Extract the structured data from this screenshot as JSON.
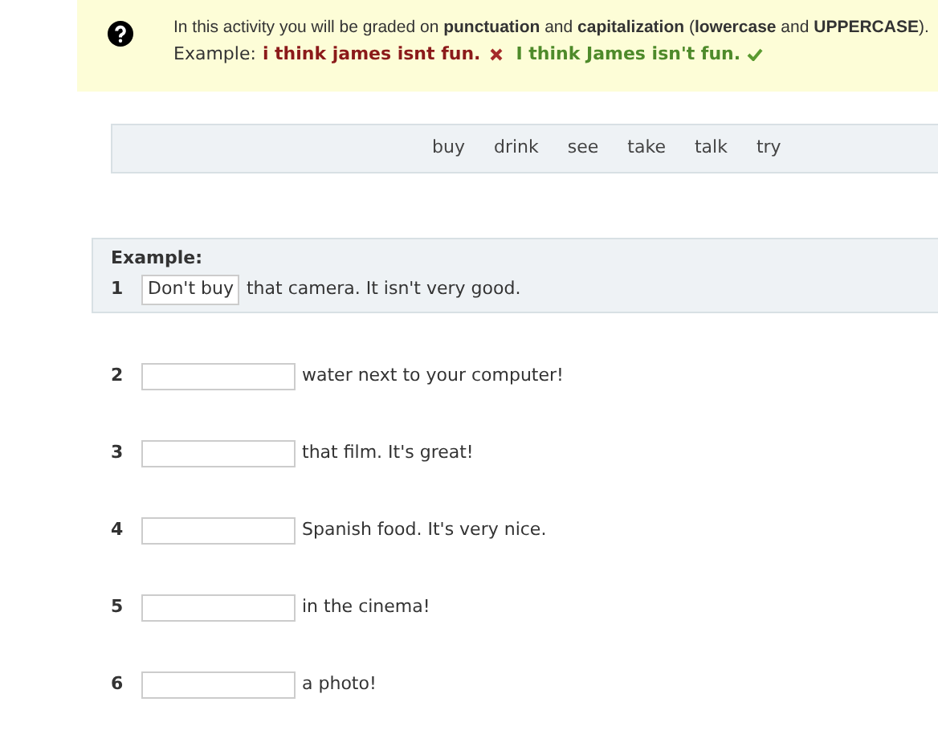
{
  "instructions": {
    "text": "In this activity you will be graded on **punctuation** and **capitalization** (**lowercase** and **UPPERCASE**).",
    "example_label": "Example:",
    "wrong_example": "i think james isnt fun.",
    "correct_example": "I think James isn't fun."
  },
  "word_bank": [
    "buy",
    "drink",
    "see",
    "take",
    "talk",
    "try"
  ],
  "example": {
    "label": "Example:",
    "number": "1",
    "answer": "Don't buy",
    "rest": "that camera. It isn't very good."
  },
  "questions": [
    {
      "number": "2",
      "rest": "water next to your computer!"
    },
    {
      "number": "3",
      "rest": "that film. It's great!"
    },
    {
      "number": "4",
      "rest": "Spanish food. It's very nice."
    },
    {
      "number": "5",
      "rest": "in the cinema!"
    },
    {
      "number": "6",
      "rest": "a photo!"
    }
  ]
}
